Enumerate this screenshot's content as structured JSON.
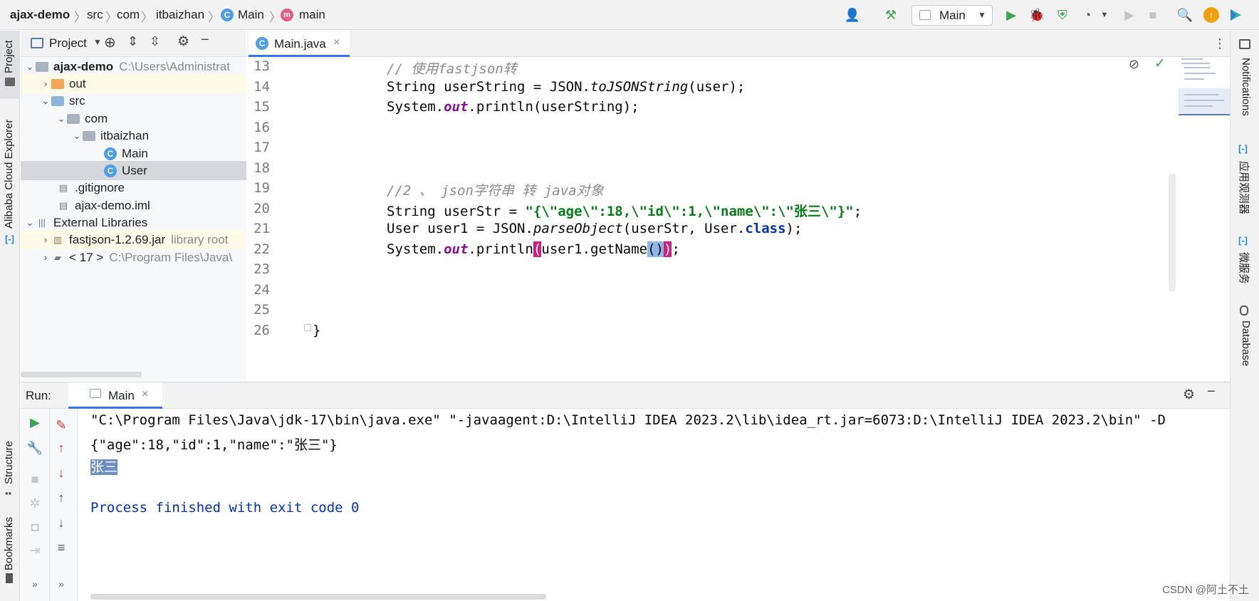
{
  "breadcrumb": [
    "ajax-demo",
    "src",
    "com",
    "itbaizhan",
    "Main",
    "main"
  ],
  "toolbar": {
    "run_config": "Main"
  },
  "left_stripe": {
    "project": "Project",
    "alibaba": "Alibaba Cloud Explorer",
    "structure": "Structure",
    "bookmarks": "Bookmarks"
  },
  "right_stripe": {
    "notifications": "Notifications",
    "app_observe": "应用观测器",
    "microservice": "微服务",
    "database": "Database"
  },
  "project_panel": {
    "title": "Project",
    "tree": [
      {
        "label": "ajax-demo",
        "extra": "C:\\Users\\Administrat"
      },
      {
        "label": "out",
        "extra": ""
      },
      {
        "label": "src",
        "extra": ""
      },
      {
        "label": "com",
        "extra": ""
      },
      {
        "label": "itbaizhan",
        "extra": ""
      },
      {
        "label": "Main",
        "extra": ""
      },
      {
        "label": "User",
        "extra": ""
      },
      {
        "label": ".gitignore",
        "extra": ""
      },
      {
        "label": "ajax-demo.iml",
        "extra": ""
      },
      {
        "label": "External Libraries",
        "extra": ""
      },
      {
        "label": "fastjson-1.2.69.jar",
        "extra": "library root"
      },
      {
        "label": "< 17 >",
        "extra": "C:\\Program Files\\Java\\"
      }
    ]
  },
  "editor": {
    "tab": "Main.java",
    "line_numbers": [
      "13",
      "14",
      "15",
      "16",
      "17",
      "18",
      "19",
      "20",
      "21",
      "22",
      "23",
      "24",
      "25",
      "26"
    ],
    "lines": {
      "l13": "// 使用fastjson转",
      "l14a": "String userString = JSON.",
      "l14b": "toJSONString",
      "l14c": "(user);",
      "l15a": "System.",
      "l15b": "out",
      "l15c": ".println(userString);",
      "l19": "//2 、 json字符串 转 java对象",
      "l20a": "String userStr = ",
      "l20b": "\"{\\\"age\\\":18,\\\"id\\\":1,\\\"name\\\":\\\"张三\\\"}\"",
      "l20c": ";",
      "l21a": "User user1 = JSON.",
      "l21b": "parseObject",
      "l21c": "(userStr, User.",
      "l21d": "class",
      "l21e": ");",
      "l22a": "System.",
      "l22b": "out",
      "l22c": ".println",
      "l22d": "(",
      "l22e": "user1.getName",
      "l22f": "()",
      "l22g": ")",
      "l22h": ";",
      "l26": "}"
    }
  },
  "run_panel": {
    "label": "Run:",
    "tab": "Main",
    "console": {
      "cmd": "\"C:\\Program Files\\Java\\jdk-17\\bin\\java.exe\" \"-javaagent:D:\\IntelliJ IDEA 2023.2\\lib\\idea_rt.jar=6073:D:\\IntelliJ IDEA 2023.2\\bin\" -D",
      "json_out": "{\"age\":18,\"id\":1,\"name\":\"张三\"}",
      "name_out": "张三",
      "finish": "Process finished with exit code 0"
    }
  },
  "watermark": "CSDN @阿土不土",
  "colors": {
    "accent": "#3574f0",
    "run_green": "#3fa34d",
    "keyword": "#0033b3",
    "string": "#067d17",
    "field": "#871094"
  }
}
